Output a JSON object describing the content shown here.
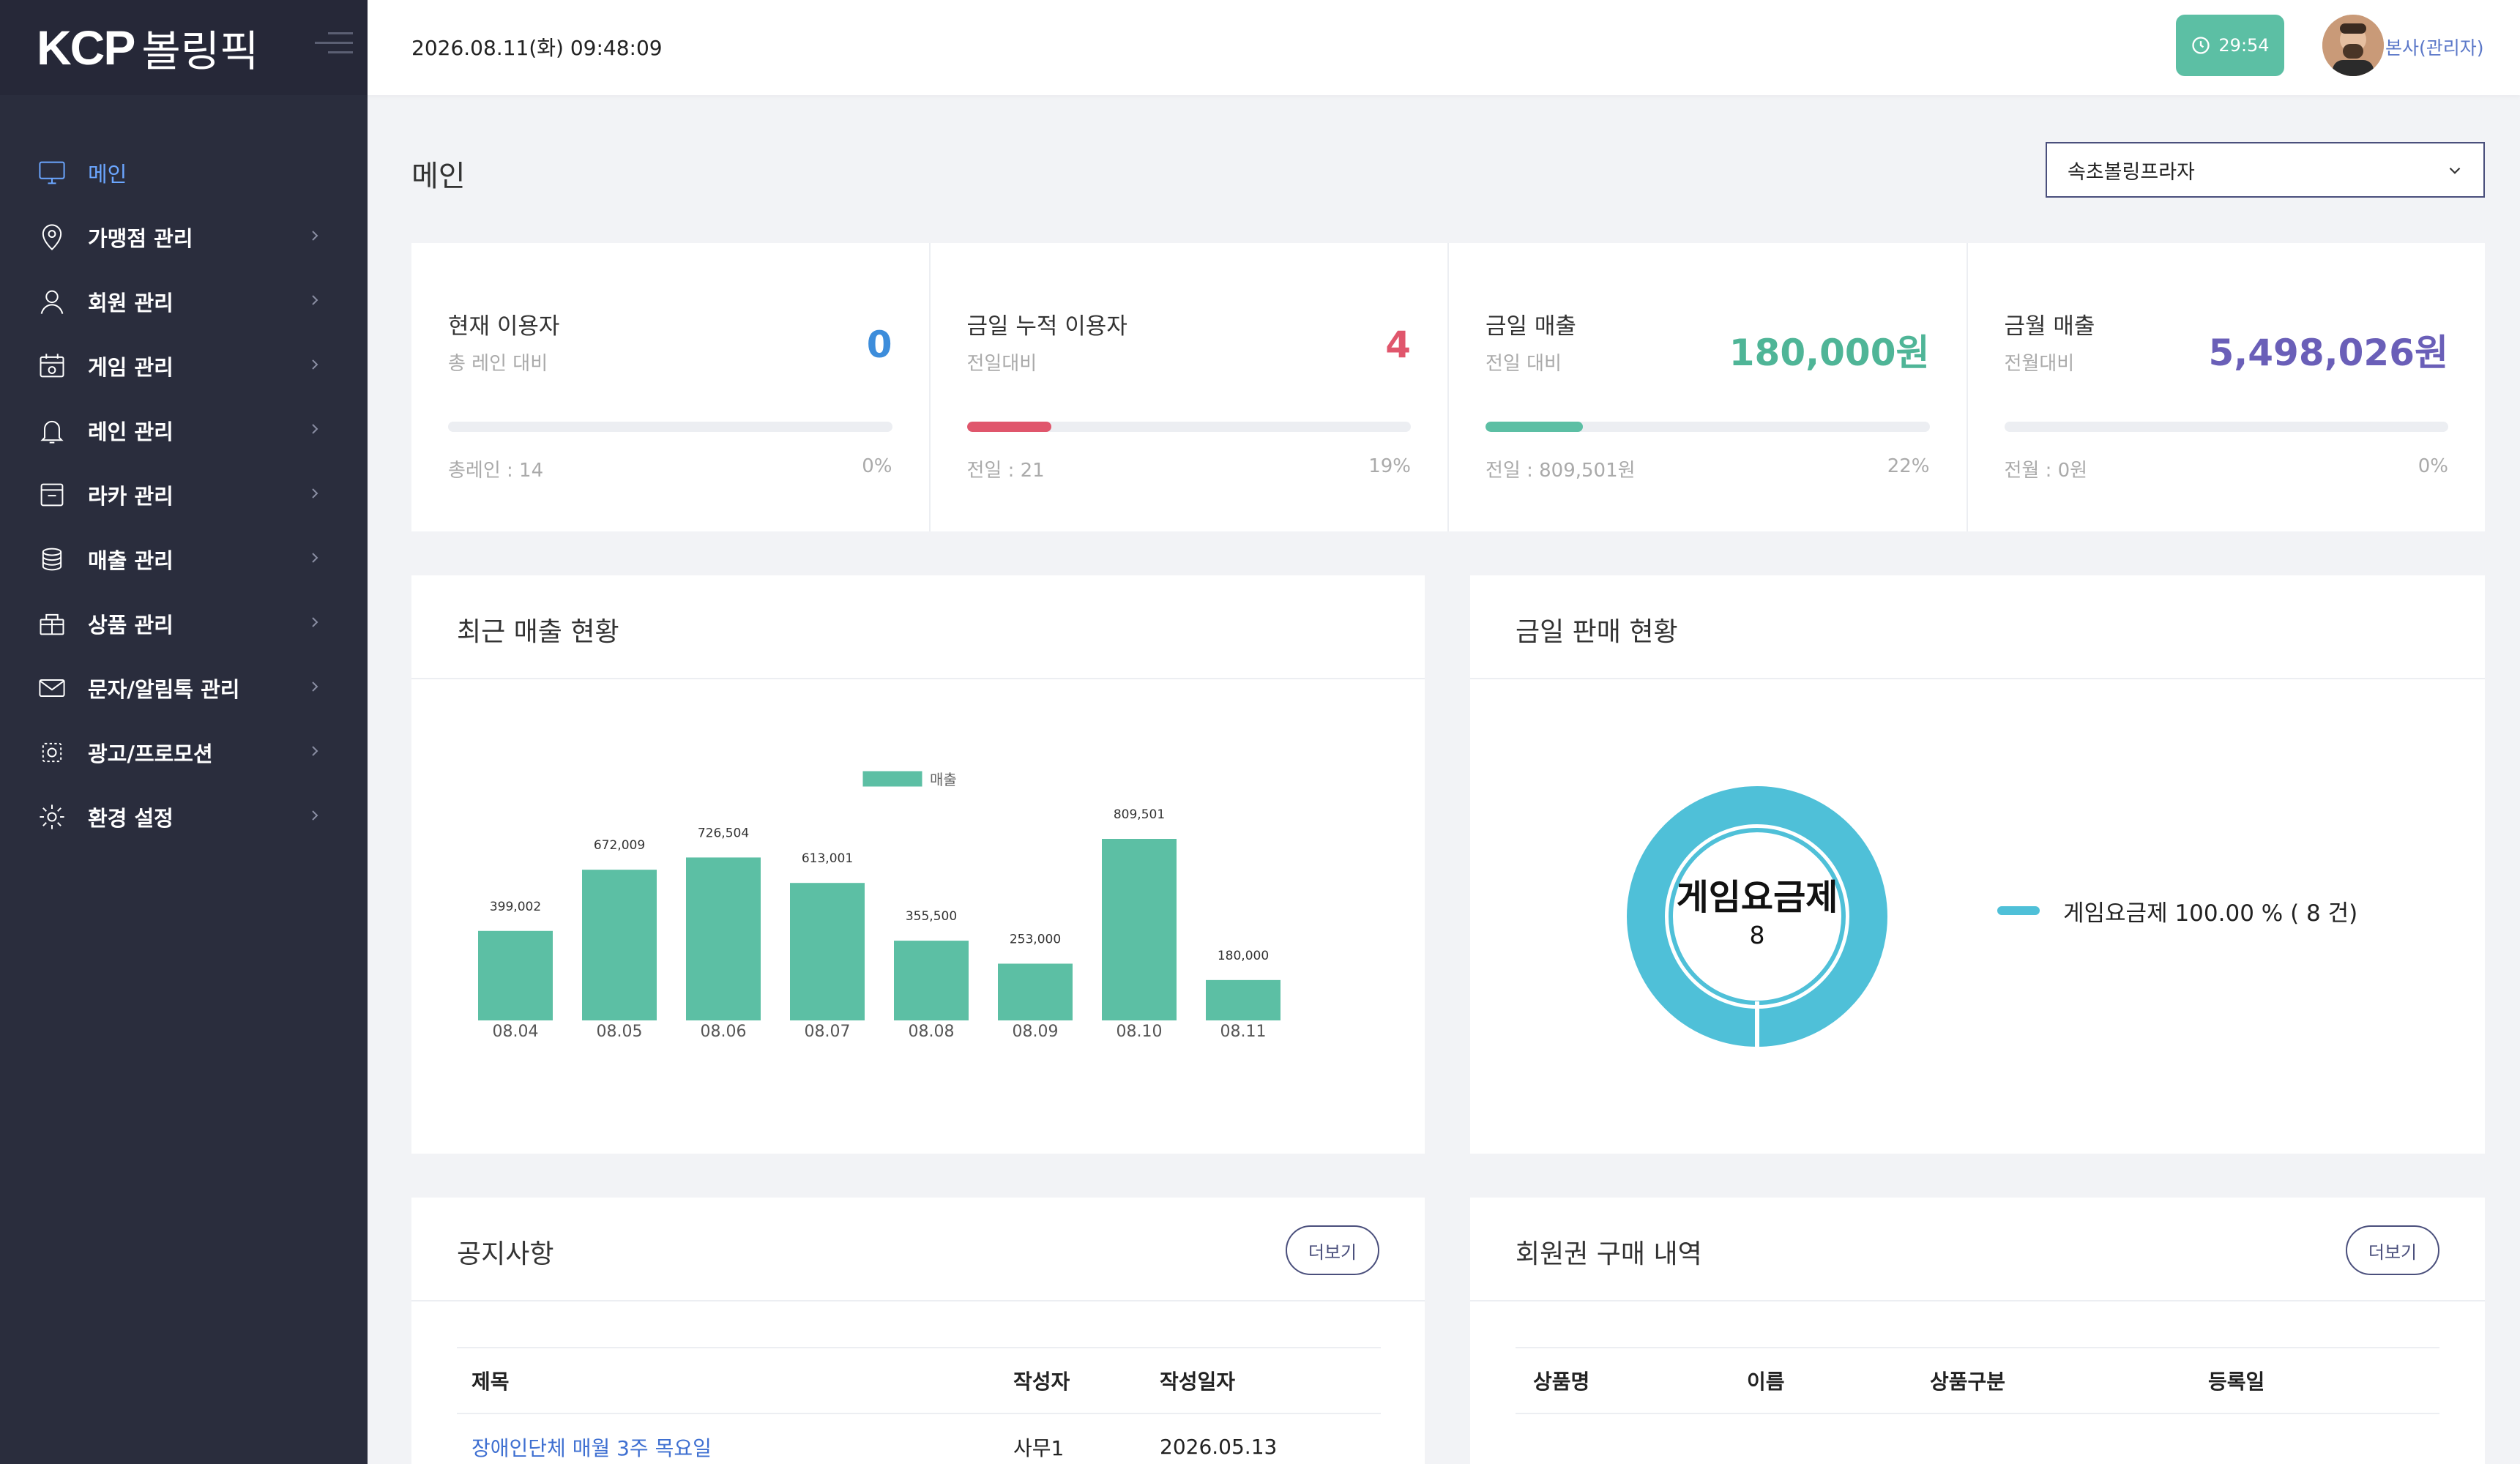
{
  "brand": {
    "logo": "KCP",
    "name": "볼링픽"
  },
  "header": {
    "datetime": "2026.08.11(화) 09:48:09",
    "timer": "29:54",
    "user": "본사(관리자)"
  },
  "sidebar": {
    "items": [
      {
        "label": "메인",
        "icon": "monitor-icon",
        "active": true
      },
      {
        "label": "가맹점 관리",
        "icon": "location-pin-icon"
      },
      {
        "label": "회원 관리",
        "icon": "user-icon"
      },
      {
        "label": "게임 관리",
        "icon": "calendar-game-icon"
      },
      {
        "label": "레인 관리",
        "icon": "bell-icon"
      },
      {
        "label": "라카 관리",
        "icon": "locker-icon"
      },
      {
        "label": "매출 관리",
        "icon": "coins-icon"
      },
      {
        "label": "상품 관리",
        "icon": "gift-icon"
      },
      {
        "label": "문자/알림톡 관리",
        "icon": "mail-icon"
      },
      {
        "label": "광고/프로모션",
        "icon": "ad-icon"
      },
      {
        "label": "환경 설정",
        "icon": "gear-icon"
      }
    ]
  },
  "main": {
    "title": "메인",
    "store_select": "속초볼링프라자"
  },
  "stats": [
    {
      "title": "현재 이용자",
      "sub": "총 레인 대비",
      "value": "0",
      "color": "#3d8ddb",
      "progress": 0,
      "bar_color": "#e7e9ee",
      "foot": "총레인 : 14",
      "pct": "0%"
    },
    {
      "title": "금일 누적 이용자",
      "sub": "전일대비",
      "value": "4",
      "color": "#e0566c",
      "progress": 19,
      "bar_color": "#e0566c",
      "foot": "전일 : 21",
      "pct": "19%"
    },
    {
      "title": "금일 매출",
      "sub": "전일 대비",
      "value": "180,000원",
      "color": "#4fb597",
      "progress": 22,
      "bar_color": "#5cbfa4",
      "foot": "전일 : 809,501원",
      "pct": "22%"
    },
    {
      "title": "금월 매출",
      "sub": "전월대비",
      "value": "5,498,026원",
      "color": "#6a5fb8",
      "progress": 0,
      "bar_color": "#e7e9ee",
      "foot": "전월 : 0원",
      "pct": "0%"
    }
  ],
  "sales_chart": {
    "title": "최근 매출 현황",
    "chart_data": {
      "type": "bar",
      "categories": [
        "08.04",
        "08.05",
        "08.06",
        "08.07",
        "08.08",
        "08.09",
        "08.10",
        "08.11"
      ],
      "series": [
        {
          "name": "매출",
          "values": [
            399002,
            672009,
            726504,
            613001,
            355500,
            253000,
            809501,
            180000
          ],
          "color": "#5cbfa4"
        }
      ],
      "labels": [
        "399,002",
        "672,009",
        "726,504",
        "613,001",
        "355,500",
        "253,000",
        "809,501",
        "180,000"
      ],
      "legend": "top"
    }
  },
  "today_sales": {
    "title": "금일 판매 현황",
    "chart_data": {
      "type": "pie",
      "categories": [
        "게임요금제"
      ],
      "values": [
        8
      ],
      "color": "#4fc0d8",
      "center_label": "게임요금제",
      "center_count": "8",
      "legend_text": "게임요금제 100.00 % ( 8 건)"
    }
  },
  "notice": {
    "title": "공지사항",
    "more": "더보기",
    "columns": [
      "제목",
      "작성자",
      "작성일자"
    ],
    "rows": [
      [
        "장애인단체 매월 3주 목요일",
        "사무1",
        "2026.05.13"
      ]
    ]
  },
  "membership": {
    "title": "회원권 구매 내역",
    "more": "더보기",
    "columns": [
      "상품명",
      "이름",
      "상품구분",
      "등록일"
    ]
  }
}
